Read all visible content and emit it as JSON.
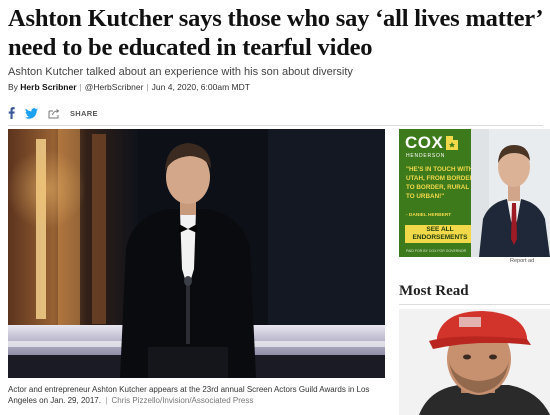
{
  "article": {
    "headline": "Ashton Kutcher says those who say ‘all lives matter’ need to be educated in tearful video",
    "subhead": "Ashton Kutcher talked about an experience with his son about diversity",
    "byline_prefix": "By",
    "author": "Herb Scribner",
    "author_handle": "@HerbScribner",
    "date": "Jun 4, 2020, 6:00am MDT",
    "share_label": "SHARE",
    "caption": "Actor and entrepreneur Ashton Kutcher appears at the 23rd annual Screen Actors Guild Awards in Los Angeles on Jan. 29, 2017.",
    "credit": "Chris Pizzello/Invision/Associated Press"
  },
  "ad": {
    "logo": "COX",
    "logo_sub": "HENDERSON",
    "quote": "\"HE'S IN TOUCH WITH UTAH, FROM BORDER TO BORDER, RURAL TO URBAN!\"",
    "attribution": "- DANIEL HERBERT",
    "cta": "SEE ALL ENDORSEMENTS",
    "paid_by": "PAID FOR BY COX FOR GOVERNOR",
    "report_label": "Report ad"
  },
  "sidebar": {
    "most_read_title": "Most Read"
  },
  "colors": {
    "facebook": "#3b5998",
    "twitter": "#1da1f2",
    "ad_green": "#3d7a1c",
    "ad_yellow": "#f2d94a"
  }
}
